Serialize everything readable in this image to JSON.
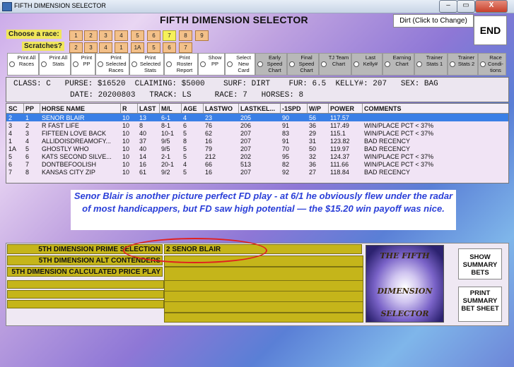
{
  "window": {
    "title": "FIFTH DIMENSION SELECTOR",
    "min": "–",
    "max": "▭",
    "close": "X"
  },
  "header": {
    "app_title": "FIFTH DIMENSION SELECTOR",
    "surface_button": "Dirt (Click to Change)",
    "end_button": "END"
  },
  "race": {
    "label": "Choose  a race:",
    "options": [
      "1",
      "2",
      "3",
      "4",
      "5",
      "6",
      "7",
      "8",
      "9"
    ],
    "selected": "7"
  },
  "scratches": {
    "label": "Scratches?",
    "options": [
      "2",
      "3",
      "4",
      "1",
      "1A",
      "5",
      "6",
      "7"
    ]
  },
  "options": [
    {
      "label": "Print All Races",
      "gray": false
    },
    {
      "label": "Print All Stats",
      "gray": false
    },
    {
      "label": "Print PP",
      "gray": false
    },
    {
      "label": "Print Selected Races",
      "gray": false
    },
    {
      "label": "Print Selected Stats",
      "gray": false
    },
    {
      "label": "Print Roster Report",
      "gray": false
    },
    {
      "label": "Show PP",
      "gray": false
    },
    {
      "label": "Select New Card",
      "gray": false
    },
    {
      "label": "Early Speed Chart",
      "gray": true
    },
    {
      "label": "Final Speed Chart",
      "gray": true
    },
    {
      "label": "TJ Team Chart",
      "gray": true
    },
    {
      "label": "Last Kelly#",
      "gray": true
    },
    {
      "label": "Earning Chart",
      "gray": true
    },
    {
      "label": "Trainer Stats 1",
      "gray": true
    },
    {
      "label": "Trainer Stats 2",
      "gray": true
    },
    {
      "label": "Race Condi- tions",
      "gray": true
    }
  ],
  "info": {
    "row1": "CLASS: C   PURSE: $16520  CLAIMING: $5000    SURF: DIRT    FUR: 6.5  KELLY#: 207   SEX: BAG",
    "row2": "DATE: 20200803   TRACK: LS     RACE: 7   HORSES: 8"
  },
  "table": {
    "headers": [
      "SC",
      "PP",
      "HORSE NAME",
      "R",
      "LAST",
      "M/L",
      "AGE",
      "LASTWO",
      "LASTKEL...",
      "-1SPD",
      "W/P",
      "POWER",
      "COMMENTS"
    ],
    "rows": [
      [
        "2",
        "1",
        "SENOR BLAIR",
        "10",
        "13",
        "6-1",
        "4",
        "23",
        "205",
        "90",
        "56",
        "117.57",
        ""
      ],
      [
        "3",
        "2",
        "R FAST LIFE",
        "10",
        "8",
        "8-1",
        "6",
        "76",
        "206",
        "91",
        "36",
        "117.49",
        "WIN/PLACE PCT < 37%"
      ],
      [
        "4",
        "3",
        "FIFTEEN LOVE BACK",
        "10",
        "40",
        "10-1",
        "5",
        "62",
        "207",
        "83",
        "29",
        "115.1",
        "WIN/PLACE PCT < 37%"
      ],
      [
        "1",
        "4",
        "ALLIDOISDREAMOFY...",
        "10",
        "37",
        "9/5",
        "8",
        "16",
        "207",
        "91",
        "31",
        "123.82",
        "BAD RECENCY"
      ],
      [
        "1A",
        "5",
        "GHOSTLY WHO",
        "10",
        "40",
        "9/5",
        "5",
        "79",
        "207",
        "70",
        "50",
        "119.97",
        "BAD RECENCY"
      ],
      [
        "5",
        "6",
        "KATS SECOND SILVE...",
        "10",
        "14",
        "2-1",
        "5",
        "212",
        "202",
        "95",
        "32",
        "124.37",
        "WIN/PLACE PCT < 37%"
      ],
      [
        "6",
        "7",
        "DONTBEFOOLISH",
        "10",
        "16",
        "20-1",
        "4",
        "66",
        "513",
        "82",
        "36",
        "111.66",
        "WIN/PLACE PCT < 37%"
      ],
      [
        "7",
        "8",
        "KANSAS CITY ZIP",
        "10",
        "61",
        "9/2",
        "5",
        "16",
        "207",
        "92",
        "27",
        "118.84",
        "BAD RECENCY"
      ]
    ]
  },
  "comment": "Senor Blair is another picture perfect FD play - at 6/1 he obviously flew under the radar of most handicappers, but FD  saw high potential — the $15.20 win payoff was nice.",
  "selections": {
    "prime_label": "5TH DIMENSION PRIME SELECTION",
    "alt_label": "5TH DIMENSION ALT CONTENDERS",
    "calc_label": "5TH DIMENSION CALCULATED PRICE PLAY",
    "prime_value": "2   SENOR BLAIR"
  },
  "logo": {
    "line1": "THE FIFTH",
    "line2": "DIMENSION",
    "line3": "SELECTOR"
  },
  "buttons": {
    "show_summary": "SHOW SUMMARY BETS",
    "print_summary": "PRINT SUMMARY BET SHEET"
  }
}
